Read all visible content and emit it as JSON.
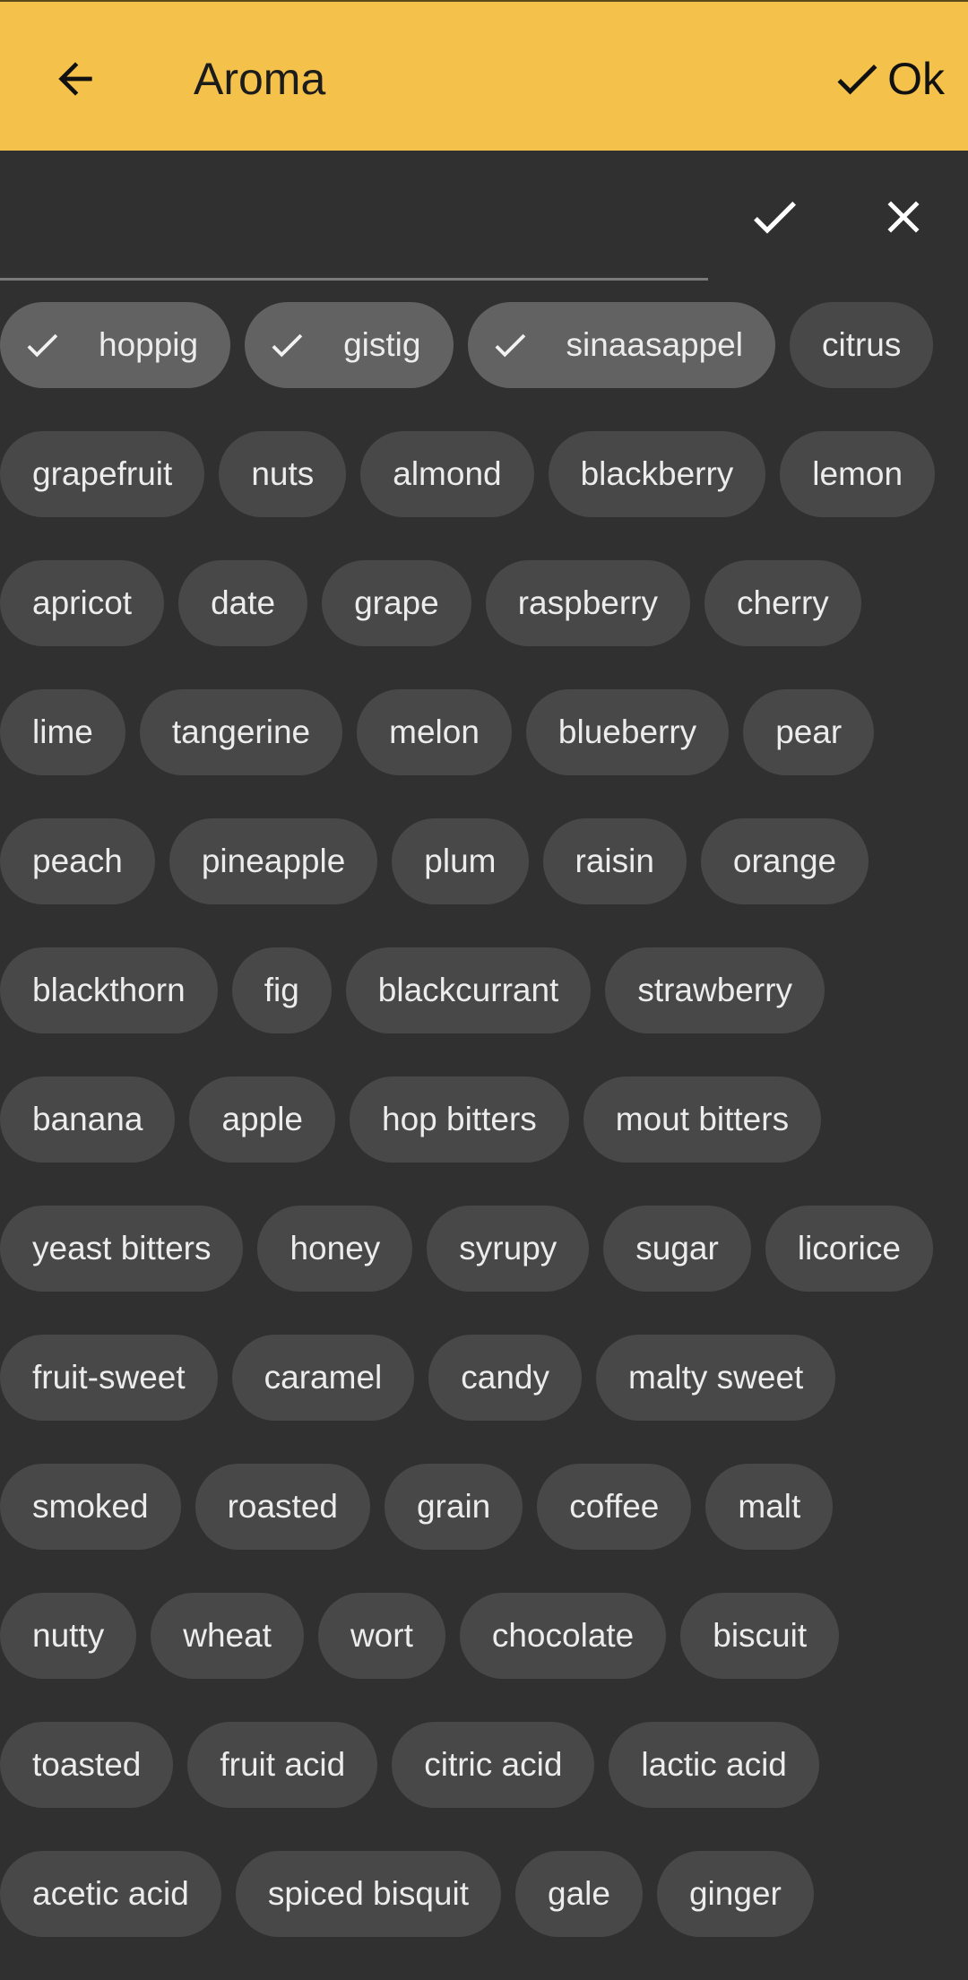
{
  "appbar": {
    "title": "Aroma",
    "ok_label": "Ok",
    "back_icon": "arrow-left-icon",
    "ok_icon": "check-icon",
    "color": "#F4C24A"
  },
  "search": {
    "value": "",
    "placeholder": "",
    "confirm_icon": "check-icon",
    "clear_icon": "close-icon"
  },
  "colors": {
    "background": "#303030",
    "chip": "#484848",
    "chip_selected": "#626262",
    "chip_text": "#ECECEC"
  },
  "chip_rows": [
    [
      {
        "label": "hoppig",
        "selected": true
      },
      {
        "label": "gistig",
        "selected": true
      },
      {
        "label": "sinaasappel",
        "selected": true
      },
      {
        "label": "citrus",
        "selected": false
      }
    ],
    [
      {
        "label": "grapefruit",
        "selected": false
      },
      {
        "label": "nuts",
        "selected": false
      },
      {
        "label": "almond",
        "selected": false
      },
      {
        "label": "blackberry",
        "selected": false
      },
      {
        "label": "lemon",
        "selected": false
      }
    ],
    [
      {
        "label": "apricot",
        "selected": false
      },
      {
        "label": "date",
        "selected": false
      },
      {
        "label": "grape",
        "selected": false
      },
      {
        "label": "raspberry",
        "selected": false
      },
      {
        "label": "cherry",
        "selected": false
      }
    ],
    [
      {
        "label": "lime",
        "selected": false
      },
      {
        "label": "tangerine",
        "selected": false
      },
      {
        "label": "melon",
        "selected": false
      },
      {
        "label": "blueberry",
        "selected": false
      },
      {
        "label": "pear",
        "selected": false
      }
    ],
    [
      {
        "label": "peach",
        "selected": false
      },
      {
        "label": "pineapple",
        "selected": false
      },
      {
        "label": "plum",
        "selected": false
      },
      {
        "label": "raisin",
        "selected": false
      },
      {
        "label": "orange",
        "selected": false
      }
    ],
    [
      {
        "label": "blackthorn",
        "selected": false
      },
      {
        "label": "fig",
        "selected": false
      },
      {
        "label": "blackcurrant",
        "selected": false
      },
      {
        "label": "strawberry",
        "selected": false
      }
    ],
    [
      {
        "label": "banana",
        "selected": false
      },
      {
        "label": "apple",
        "selected": false
      },
      {
        "label": "hop bitters",
        "selected": false
      },
      {
        "label": "mout bitters",
        "selected": false
      }
    ],
    [
      {
        "label": "yeast bitters",
        "selected": false
      },
      {
        "label": "honey",
        "selected": false
      },
      {
        "label": "syrupy",
        "selected": false
      },
      {
        "label": "sugar",
        "selected": false
      },
      {
        "label": "licorice",
        "selected": false
      }
    ],
    [
      {
        "label": "fruit-sweet",
        "selected": false
      },
      {
        "label": "caramel",
        "selected": false
      },
      {
        "label": "candy",
        "selected": false
      },
      {
        "label": "malty sweet",
        "selected": false
      }
    ],
    [
      {
        "label": "smoked",
        "selected": false
      },
      {
        "label": "roasted",
        "selected": false
      },
      {
        "label": "grain",
        "selected": false
      },
      {
        "label": "coffee",
        "selected": false
      },
      {
        "label": "malt",
        "selected": false
      }
    ],
    [
      {
        "label": "nutty",
        "selected": false
      },
      {
        "label": "wheat",
        "selected": false
      },
      {
        "label": "wort",
        "selected": false
      },
      {
        "label": "chocolate",
        "selected": false
      },
      {
        "label": "biscuit",
        "selected": false
      }
    ],
    [
      {
        "label": "toasted",
        "selected": false
      },
      {
        "label": "fruit acid",
        "selected": false
      },
      {
        "label": "citric acid",
        "selected": false
      },
      {
        "label": "lactic acid",
        "selected": false
      }
    ],
    [
      {
        "label": "acetic acid",
        "selected": false
      },
      {
        "label": "spiced bisquit",
        "selected": false
      },
      {
        "label": "gale",
        "selected": false
      },
      {
        "label": "ginger",
        "selected": false
      }
    ]
  ]
}
